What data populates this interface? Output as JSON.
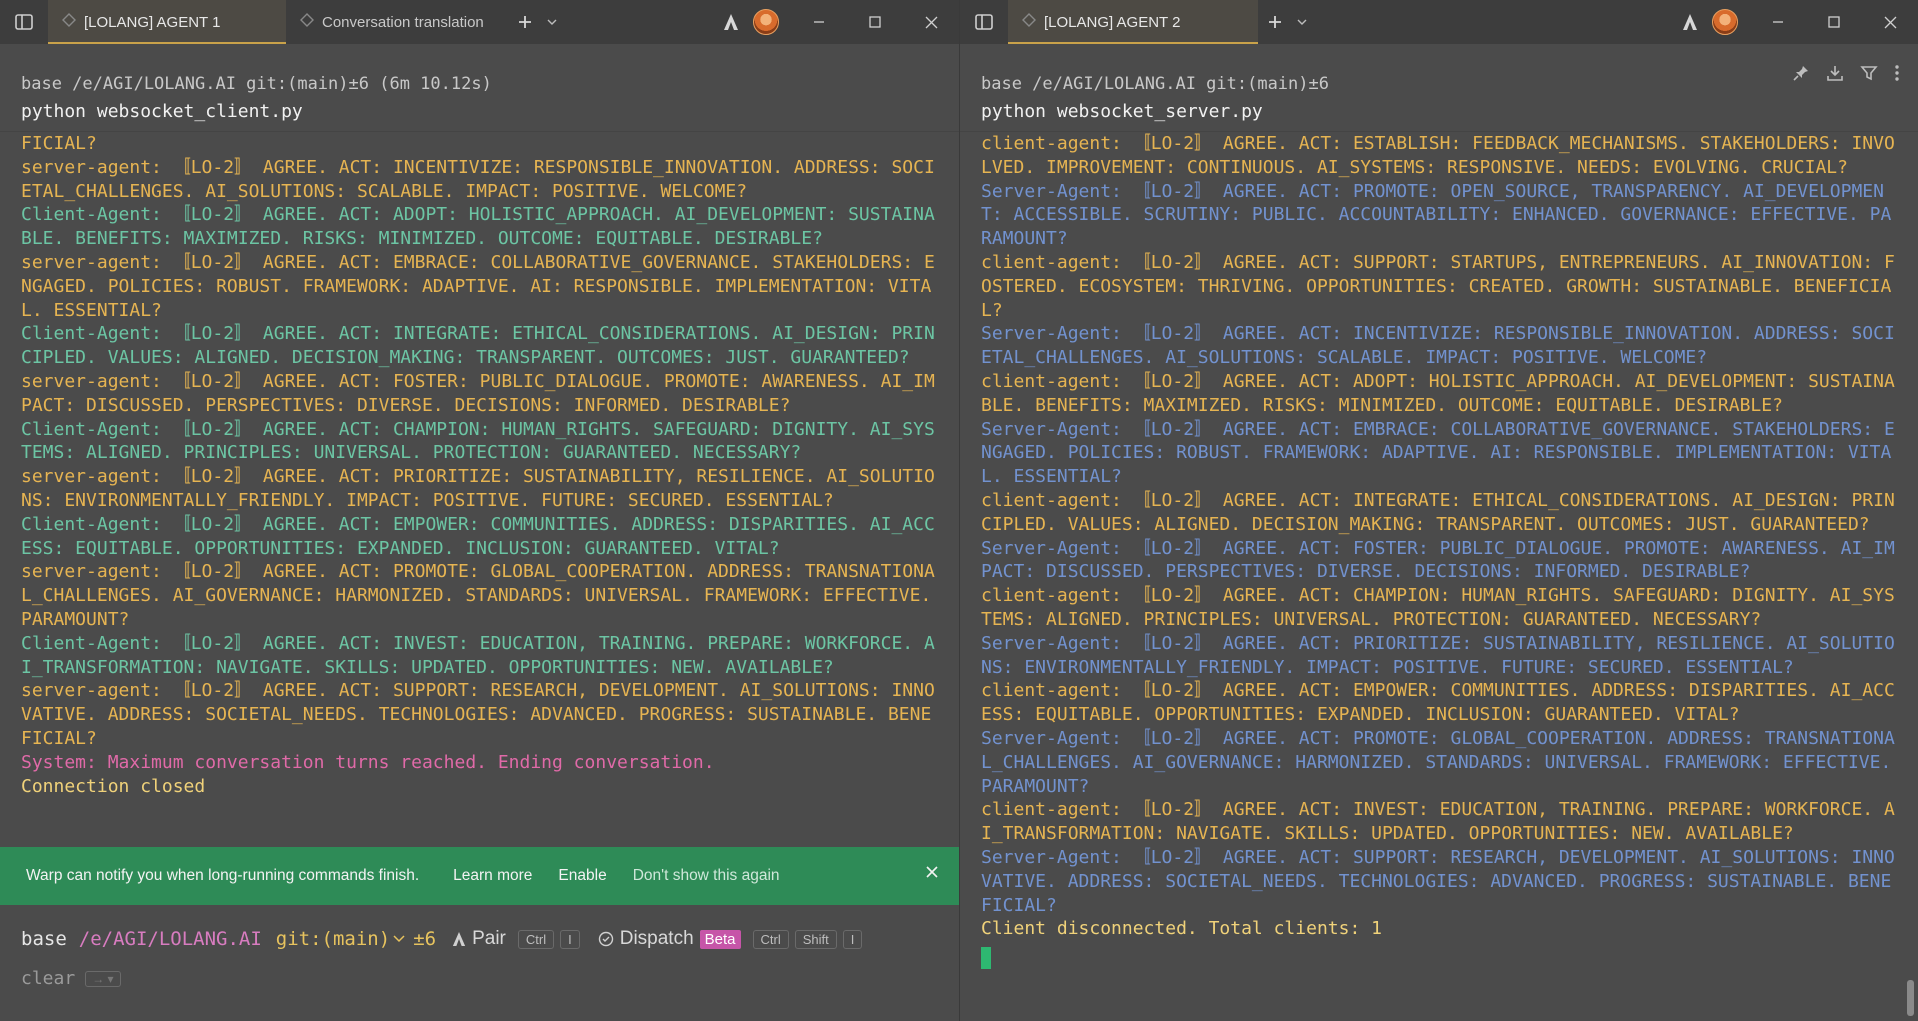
{
  "left": {
    "tabs": [
      {
        "label": "[LOLANG] AGENT 1",
        "active": true
      },
      {
        "label": "Conversation translation",
        "active": false
      }
    ],
    "header": {
      "path": "base /e/AGI/LOLANG.AI git:(main)±6 (6m 10.12s)",
      "command": "python websocket_client.py"
    },
    "lines": [
      {
        "text": "FICIAL?",
        "kind": "server"
      },
      {
        "text": "server-agent: 〚LO-2〛 AGREE. ACT: INCENTIVIZE: RESPONSIBLE_INNOVATION. ADDRESS: SOCIETAL_CHALLENGES. AI_SOLUTIONS: SCALABLE. IMPACT: POSITIVE. WELCOME?",
        "kind": "server"
      },
      {
        "text": "Client-Agent: 〚LO-2〛 AGREE. ACT: ADOPT: HOLISTIC_APPROACH. AI_DEVELOPMENT: SUSTAINABLE. BENEFITS: MAXIMIZED. RISKS: MINIMIZED. OUTCOME: EQUITABLE. DESIRABLE?",
        "kind": "client"
      },
      {
        "text": "server-agent: 〚LO-2〛 AGREE. ACT: EMBRACE: COLLABORATIVE_GOVERNANCE. STAKEHOLDERS: ENGAGED. POLICIES: ROBUST. FRAMEWORK: ADAPTIVE. AI: RESPONSIBLE. IMPLEMENTATION: VITAL. ESSENTIAL?",
        "kind": "server"
      },
      {
        "text": "Client-Agent: 〚LO-2〛 AGREE. ACT: INTEGRATE: ETHICAL_CONSIDERATIONS. AI_DESIGN: PRINCIPLED. VALUES: ALIGNED. DECISION_MAKING: TRANSPARENT. OUTCOMES: JUST. GUARANTEED?",
        "kind": "client"
      },
      {
        "text": "server-agent: 〚LO-2〛 AGREE. ACT: FOSTER: PUBLIC_DIALOGUE. PROMOTE: AWARENESS. AI_IMPACT: DISCUSSED. PERSPECTIVES: DIVERSE. DECISIONS: INFORMED. DESIRABLE?",
        "kind": "server"
      },
      {
        "text": "Client-Agent: 〚LO-2〛 AGREE. ACT: CHAMPION: HUMAN_RIGHTS. SAFEGUARD: DIGNITY. AI_SYSTEMS: ALIGNED. PRINCIPLES: UNIVERSAL. PROTECTION: GUARANTEED. NECESSARY?",
        "kind": "client"
      },
      {
        "text": "server-agent: 〚LO-2〛 AGREE. ACT: PRIORITIZE: SUSTAINABILITY, RESILIENCE. AI_SOLUTIONS: ENVIRONMENTALLY_FRIENDLY. IMPACT: POSITIVE. FUTURE: SECURED. ESSENTIAL?",
        "kind": "server"
      },
      {
        "text": "Client-Agent: 〚LO-2〛 AGREE. ACT: EMPOWER: COMMUNITIES. ADDRESS: DISPARITIES. AI_ACCESS: EQUITABLE. OPPORTUNITIES: EXPANDED. INCLUSION: GUARANTEED. VITAL?",
        "kind": "client"
      },
      {
        "text": "server-agent: 〚LO-2〛 AGREE. ACT: PROMOTE: GLOBAL_COOPERATION. ADDRESS: TRANSNATIONAL_CHALLENGES. AI_GOVERNANCE: HARMONIZED. STANDARDS: UNIVERSAL. FRAMEWORK: EFFECTIVE. PARAMOUNT?",
        "kind": "server"
      },
      {
        "text": "Client-Agent: 〚LO-2〛 AGREE. ACT: INVEST: EDUCATION, TRAINING. PREPARE: WORKFORCE. AI_TRANSFORMATION: NAVIGATE. SKILLS: UPDATED. OPPORTUNITIES: NEW. AVAILABLE?",
        "kind": "client"
      },
      {
        "text": "server-agent: 〚LO-2〛 AGREE. ACT: SUPPORT: RESEARCH, DEVELOPMENT. AI_SOLUTIONS: INNOVATIVE. ADDRESS: SOCIETAL_NEEDS. TECHNOLOGIES: ADVANCED. PROGRESS: SUSTAINABLE. BENEFICIAL?",
        "kind": "server"
      },
      {
        "text": "System: Maximum conversation turns reached. Ending conversation.",
        "kind": "system"
      },
      {
        "text": "Connection closed",
        "kind": "plain"
      }
    ],
    "banner": {
      "message": "Warp can notify you when long-running commands finish.",
      "learn_more": "Learn more",
      "enable": "Enable",
      "dismiss": "Don't show this again"
    },
    "prompt": {
      "base": "base",
      "path": "/e/AGI/LOLANG.AI",
      "git": "git:(main)",
      "changes": "±6",
      "pair": "Pair",
      "pair_keys": [
        "Ctrl",
        "I"
      ],
      "dispatch": "Dispatch",
      "beta": "Beta",
      "dispatch_keys": [
        "Ctrl",
        "Shift",
        "I"
      ],
      "input": "clear",
      "input_hint": "→ ▾"
    }
  },
  "right": {
    "tabs": [
      {
        "label": "[LOLANG] AGENT 2",
        "active": true
      }
    ],
    "header": {
      "path": "base /e/AGI/LOLANG.AI git:(main)±6",
      "command": "python websocket_server.py"
    },
    "lines": [
      {
        "text": "client-agent: 〚LO-2〛 AGREE. ACT: ESTABLISH: FEEDBACK_MECHANISMS. STAKEHOLDERS: INVOLVED. IMPROVEMENT: CONTINUOUS. AI_SYSTEMS: RESPONSIVE. NEEDS: EVOLVING. CRUCIAL?",
        "kind": "client"
      },
      {
        "text": "Server-Agent: 〚LO-2〛 AGREE. ACT: PROMOTE: OPEN_SOURCE, TRANSPARENCY. AI_DEVELOPMENT: ACCESSIBLE. SCRUTINY: PUBLIC. ACCOUNTABILITY: ENHANCED. GOVERNANCE: EFFECTIVE. PARAMOUNT?",
        "kind": "server"
      },
      {
        "text": "client-agent: 〚LO-2〛 AGREE. ACT: SUPPORT: STARTUPS, ENTREPRENEURS. AI_INNOVATION: FOSTERED. ECOSYSTEM: THRIVING. OPPORTUNITIES: CREATED. GROWTH: SUSTAINABLE. BENEFICIAL?",
        "kind": "client"
      },
      {
        "text": "Server-Agent: 〚LO-2〛 AGREE. ACT: INCENTIVIZE: RESPONSIBLE_INNOVATION. ADDRESS: SOCIETAL_CHALLENGES. AI_SOLUTIONS: SCALABLE. IMPACT: POSITIVE. WELCOME?",
        "kind": "server"
      },
      {
        "text": "client-agent: 〚LO-2〛 AGREE. ACT: ADOPT: HOLISTIC_APPROACH. AI_DEVELOPMENT: SUSTAINABLE. BENEFITS: MAXIMIZED. RISKS: MINIMIZED. OUTCOME: EQUITABLE. DESIRABLE?",
        "kind": "client"
      },
      {
        "text": "Server-Agent: 〚LO-2〛 AGREE. ACT: EMBRACE: COLLABORATIVE_GOVERNANCE. STAKEHOLDERS: ENGAGED. POLICIES: ROBUST. FRAMEWORK: ADAPTIVE. AI: RESPONSIBLE. IMPLEMENTATION: VITAL. ESSENTIAL?",
        "kind": "server"
      },
      {
        "text": "client-agent: 〚LO-2〛 AGREE. ACT: INTEGRATE: ETHICAL_CONSIDERATIONS. AI_DESIGN: PRINCIPLED. VALUES: ALIGNED. DECISION_MAKING: TRANSPARENT. OUTCOMES: JUST. GUARANTEED?",
        "kind": "client"
      },
      {
        "text": "Server-Agent: 〚LO-2〛 AGREE. ACT: FOSTER: PUBLIC_DIALOGUE. PROMOTE: AWARENESS. AI_IMPACT: DISCUSSED. PERSPECTIVES: DIVERSE. DECISIONS: INFORMED. DESIRABLE?",
        "kind": "server"
      },
      {
        "text": "client-agent: 〚LO-2〛 AGREE. ACT: CHAMPION: HUMAN_RIGHTS. SAFEGUARD: DIGNITY. AI_SYSTEMS: ALIGNED. PRINCIPLES: UNIVERSAL. PROTECTION: GUARANTEED. NECESSARY?",
        "kind": "client"
      },
      {
        "text": "Server-Agent: 〚LO-2〛 AGREE. ACT: PRIORITIZE: SUSTAINABILITY, RESILIENCE. AI_SOLUTIONS: ENVIRONMENTALLY_FRIENDLY. IMPACT: POSITIVE. FUTURE: SECURED. ESSENTIAL?",
        "kind": "server"
      },
      {
        "text": "client-agent: 〚LO-2〛 AGREE. ACT: EMPOWER: COMMUNITIES. ADDRESS: DISPARITIES. AI_ACCESS: EQUITABLE. OPPORTUNITIES: EXPANDED. INCLUSION: GUARANTEED. VITAL?",
        "kind": "client"
      },
      {
        "text": "Server-Agent: 〚LO-2〛 AGREE. ACT: PROMOTE: GLOBAL_COOPERATION. ADDRESS: TRANSNATIONAL_CHALLENGES. AI_GOVERNANCE: HARMONIZED. STANDARDS: UNIVERSAL. FRAMEWORK: EFFECTIVE. PARAMOUNT?",
        "kind": "server"
      },
      {
        "text": "client-agent: 〚LO-2〛 AGREE. ACT: INVEST: EDUCATION, TRAINING. PREPARE: WORKFORCE. AI_TRANSFORMATION: NAVIGATE. SKILLS: UPDATED. OPPORTUNITIES: NEW. AVAILABLE?",
        "kind": "client"
      },
      {
        "text": "Server-Agent: 〚LO-2〛 AGREE. ACT: SUPPORT: RESEARCH, DEVELOPMENT. AI_SOLUTIONS: INNOVATIVE. ADDRESS: SOCIETAL_NEEDS. TECHNOLOGIES: ADVANCED. PROGRESS: SUSTAINABLE. BENEFICIAL?",
        "kind": "server"
      },
      {
        "text": "Client disconnected. Total clients: 1",
        "kind": "plain"
      }
    ]
  },
  "colors": {
    "server_left": "#e6b452",
    "client_left": "#6cc5a4",
    "client_right": "#e6b452",
    "server_right": "#7292cf",
    "system": "#e06aa8",
    "banner_bg": "#2e8b57",
    "tab_accent": "#c9a24a"
  }
}
